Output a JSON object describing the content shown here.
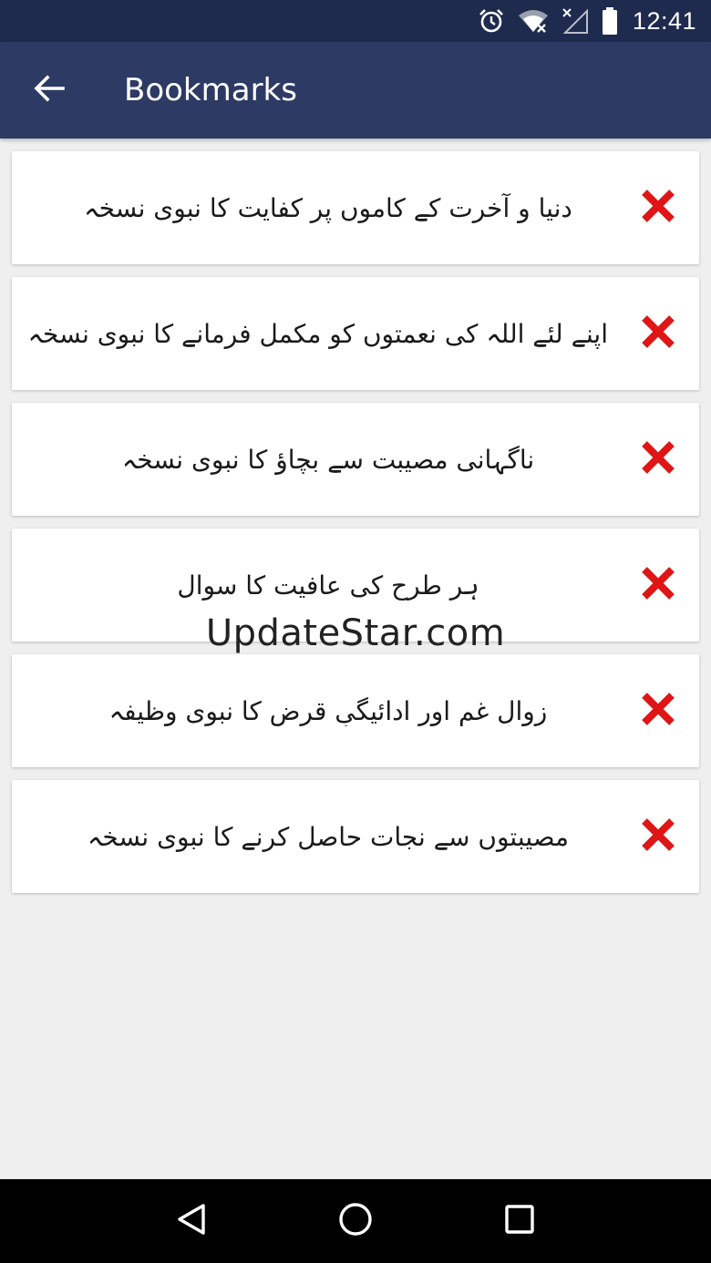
{
  "status_bar": {
    "time": "12:41",
    "icons": [
      "alarm-icon",
      "wifi-off-icon",
      "signal-off-icon",
      "battery-icon"
    ]
  },
  "app_bar": {
    "title": "Bookmarks",
    "back_icon": "arrow-left-icon"
  },
  "bookmarks": [
    {
      "title": "دنیا و آخرت کے کاموں پر کفایت کا نبوی نسخہ"
    },
    {
      "title": "اپنے لئے اللہ کی نعمتوں کو مکمل فرمانے کا نبوی نسخہ"
    },
    {
      "title": "ناگہانی مصیبت سے بچاؤ کا نبوی نسخہ"
    },
    {
      "title": "ہر طرح کی عافیت کا سوال"
    },
    {
      "title": "زوالِ غم اور ادائیگیِ قرض کا نبوی وظیفہ"
    },
    {
      "title": "مصیبتوں سے نجات حاصل کرنے کا نبوی نسخہ"
    }
  ],
  "remove_icon": "close-x-icon",
  "remove_color": "#e01515",
  "watermark": "UpdateStar.com",
  "nav_bar": {
    "icons": [
      "back-triangle-icon",
      "home-circle-icon",
      "recents-square-icon"
    ]
  },
  "colors": {
    "status_bar": "#1f2a4f",
    "app_bar": "#2d3a64",
    "background": "#efefef"
  }
}
